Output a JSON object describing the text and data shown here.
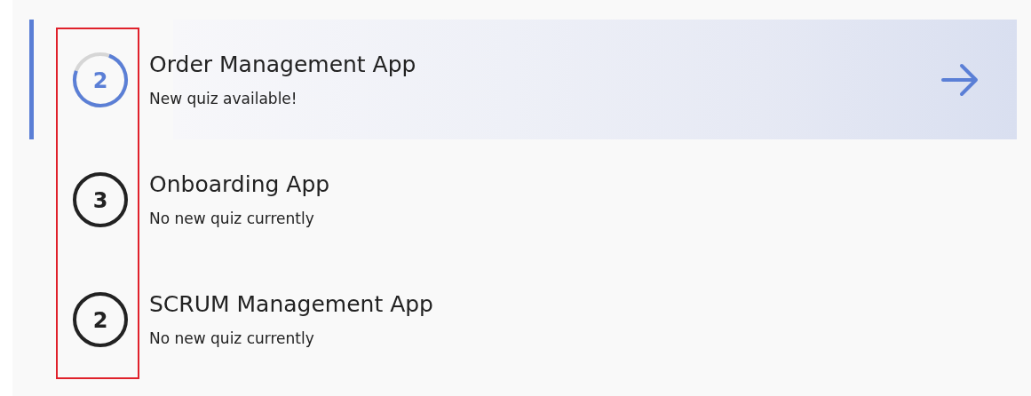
{
  "apps": [
    {
      "kind": "progress",
      "title": "Order Management App",
      "subtitle": "New quiz available!",
      "count": "2",
      "selected": true,
      "level": 0.75
    },
    {
      "kind": "plain",
      "title": "Onboarding App",
      "subtitle": "No new quiz currently",
      "count": "3",
      "selected": false
    },
    {
      "kind": "plain",
      "title": "SCRUM Management App",
      "subtitle": "No new quiz currently",
      "count": "2",
      "selected": false
    }
  ]
}
